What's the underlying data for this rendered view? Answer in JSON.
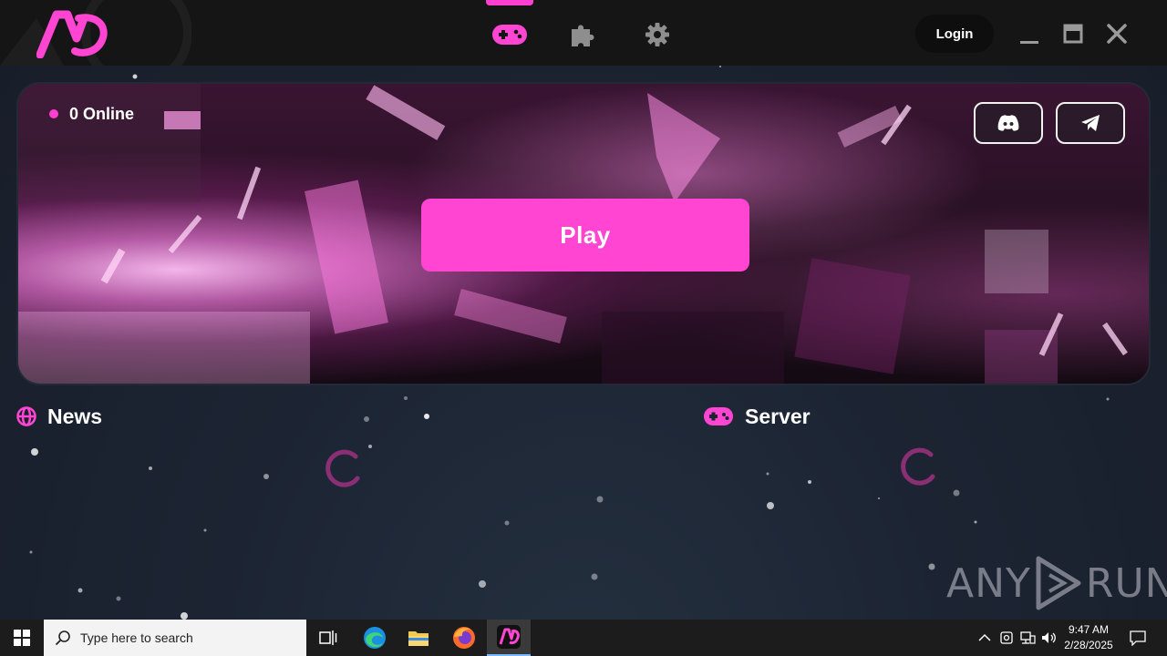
{
  "titlebar": {
    "nav_tabs": [
      {
        "name": "gamepad-icon",
        "active": true
      },
      {
        "name": "puzzle-icon",
        "active": false
      },
      {
        "name": "gear-icon",
        "active": false
      }
    ],
    "login_label": "Login"
  },
  "banner": {
    "online_text": "0 Online",
    "play_label": "Play",
    "social": [
      "discord-icon",
      "telegram-icon"
    ]
  },
  "sections": {
    "news_title": "News",
    "server_title": "Server"
  },
  "watermark": {
    "left": "ANY",
    "right": "RUN"
  },
  "taskbar": {
    "search_placeholder": "Type here to search",
    "time": "9:47 AM",
    "date": "2/28/2025"
  },
  "colors": {
    "accent": "#ff3fcf",
    "titlebar_bg": "#151515",
    "app_bg": "#1c2433",
    "taskbar_bg": "#1c1c1c"
  }
}
